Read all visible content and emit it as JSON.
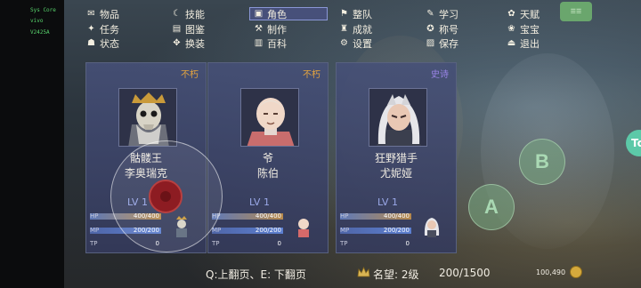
{
  "system": {
    "lines": [
      "Sys Core",
      "vivo",
      "V2425A"
    ]
  },
  "menu": {
    "items": [
      {
        "label": "物品",
        "icon": "bag-icon",
        "glyph": "✉"
      },
      {
        "label": "技能",
        "icon": "moon-icon",
        "glyph": "☾"
      },
      {
        "label": "角色",
        "icon": "portrait-icon",
        "glyph": "▣",
        "active": true
      },
      {
        "label": "整队",
        "icon": "formation-icon",
        "glyph": "⚑"
      },
      {
        "label": "学习",
        "icon": "book-icon",
        "glyph": "✎"
      },
      {
        "label": "天赋",
        "icon": "talent-icon",
        "glyph": "✿"
      },
      {
        "label": "任务",
        "icon": "quest-icon",
        "glyph": "✦"
      },
      {
        "label": "图鉴",
        "icon": "codex-icon",
        "glyph": "▤"
      },
      {
        "label": "制作",
        "icon": "hammer-icon",
        "glyph": "⚒"
      },
      {
        "label": "成就",
        "icon": "trophy-icon",
        "glyph": "♜"
      },
      {
        "label": "称号",
        "icon": "medal-icon",
        "glyph": "✪"
      },
      {
        "label": "宝宝",
        "icon": "pet-icon",
        "glyph": "❀"
      },
      {
        "label": "状态",
        "icon": "status-icon",
        "glyph": "☗"
      },
      {
        "label": "换装",
        "icon": "outfit-icon",
        "glyph": "✥"
      },
      {
        "label": "百科",
        "icon": "encyclopedia-icon",
        "glyph": "▥"
      },
      {
        "label": "设置",
        "icon": "gear-icon",
        "glyph": "⚙"
      },
      {
        "label": "保存",
        "icon": "save-icon",
        "glyph": "▨"
      },
      {
        "label": "退出",
        "icon": "exit-icon",
        "glyph": "⏏"
      }
    ]
  },
  "cards": [
    {
      "rank": "不朽",
      "rank_color": "#e3a33f",
      "title": "骷髅王",
      "name": "李奥瑞克",
      "lv": "LV 1",
      "hp_label": "HP",
      "hp": "400/400",
      "hp_fraction": 1.0,
      "mp_label": "MP",
      "mp": "200/200",
      "mp_fraction": 1.0,
      "tp_label": "TP",
      "tp": "0",
      "tp_fraction": 0,
      "portrait_icon": "skeleton-king-portrait",
      "sprite_icon": "skeleton-king-sprite"
    },
    {
      "rank": "不朽",
      "rank_color": "#e3a33f",
      "title": "爷",
      "name": "陈伯",
      "lv": "LV 1",
      "hp_label": "HP",
      "hp": "400/400",
      "hp_fraction": 1.0,
      "mp_label": "MP",
      "mp": "200/200",
      "mp_fraction": 1.0,
      "tp_label": "TP",
      "tp": "0",
      "tp_fraction": 0,
      "portrait_icon": "old-man-portrait",
      "sprite_icon": "old-man-sprite"
    },
    {
      "rank": "史诗",
      "rank_color": "#9a84e6",
      "title": "狂野猎手",
      "name": "尤妮娅",
      "lv": "LV 1",
      "hp_label": "HP",
      "hp": "400/400",
      "hp_fraction": 1.0,
      "mp_label": "MP",
      "mp": "200/200",
      "mp_fraction": 1.0,
      "tp_label": "TP",
      "tp": "0",
      "tp_fraction": 0,
      "portrait_icon": "huntress-portrait",
      "sprite_icon": "huntress-sprite"
    }
  ],
  "controls": {
    "b_label": "B",
    "a_label": "A",
    "side_tab": "Tc"
  },
  "bottom": {
    "hint": "Q:上翻页、E: 下翻页",
    "reputation": "名望: 2级",
    "reputation_progress": "200/1500",
    "money": "100,490"
  }
}
